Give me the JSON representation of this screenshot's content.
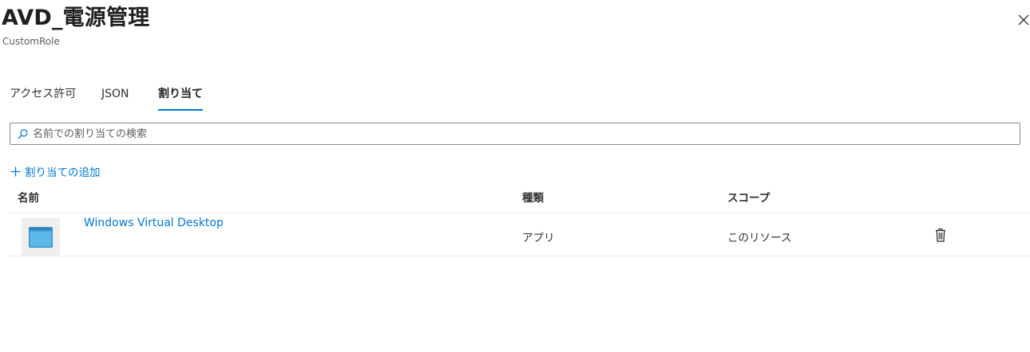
{
  "header": {
    "title": "AVD_電源管理",
    "subtitle": "CustomRole",
    "close_icon": "close-icon"
  },
  "tabs": [
    {
      "label": "アクセス許可",
      "selected": false
    },
    {
      "label": "JSON",
      "selected": false
    },
    {
      "label": "割り当て",
      "selected": true
    }
  ],
  "search": {
    "placeholder": "名前での割り当ての検索",
    "value": "",
    "icon": "search-icon"
  },
  "add_assignment": {
    "label": "割り当ての追加",
    "icon": "plus-icon"
  },
  "table": {
    "columns": [
      "名前",
      "種類",
      "スコープ"
    ],
    "rows": [
      {
        "name": "Windows Virtual Desktop",
        "type": "アプリ",
        "scope": "このリソース",
        "icon": "app-window-icon",
        "action_icon": "trash-icon"
      }
    ]
  },
  "colors": {
    "accent": "#0078d4",
    "text": "#323130",
    "border": "#8a8886",
    "divider": "#edebe9"
  }
}
